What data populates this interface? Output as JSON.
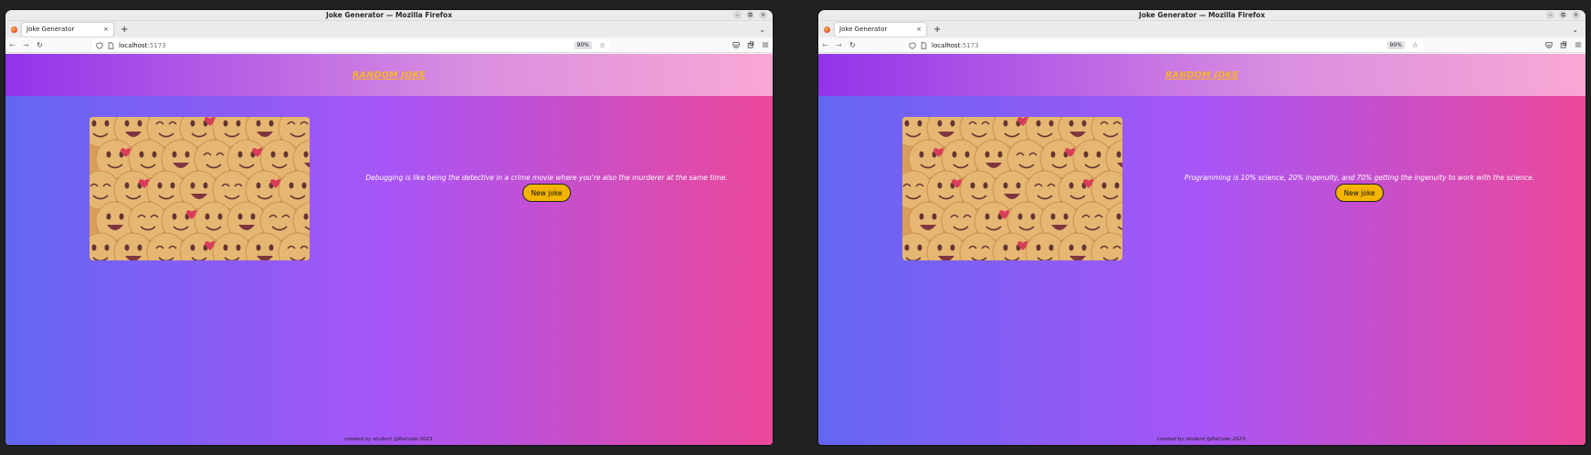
{
  "browser": {
    "window_title": "Joke Generator — Mozilla Firefox",
    "controls": {
      "minimize": "–",
      "restore": "⧉",
      "close": "×"
    },
    "tab_title": "Joke Generator",
    "tab_close": "×",
    "new_tab": "+",
    "tab_list": "⌄",
    "back": "←",
    "forward": "→",
    "reload": "↻",
    "url_host": "localhost",
    "url_port": ":5173",
    "zoom": "90%",
    "bookmark_star": "☆"
  },
  "app": {
    "title": "RANDOM JOKE",
    "button_label": "New joke",
    "footer": "created by student @BeCode 2023."
  },
  "windows": [
    {
      "joke": "Debugging is like being the detective in a crime movie where you're also the murderer at the same time."
    },
    {
      "joke": "Programming is 10% science, 20% ingenuity, and 70% getting the ingenuity to work with the science."
    }
  ],
  "colors": {
    "page_gradient": [
      "#6366f1",
      "#a855f7",
      "#ec4899"
    ],
    "header_gradient": [
      "#9333ea",
      "#d98ee0",
      "#f9a8d4"
    ],
    "title": "#f7b520",
    "button": "#f3b400"
  },
  "icons": [
    "firefox-icon",
    "shield-icon",
    "page-icon",
    "star-icon",
    "pocket-icon",
    "extensions-icon",
    "menu-icon"
  ]
}
